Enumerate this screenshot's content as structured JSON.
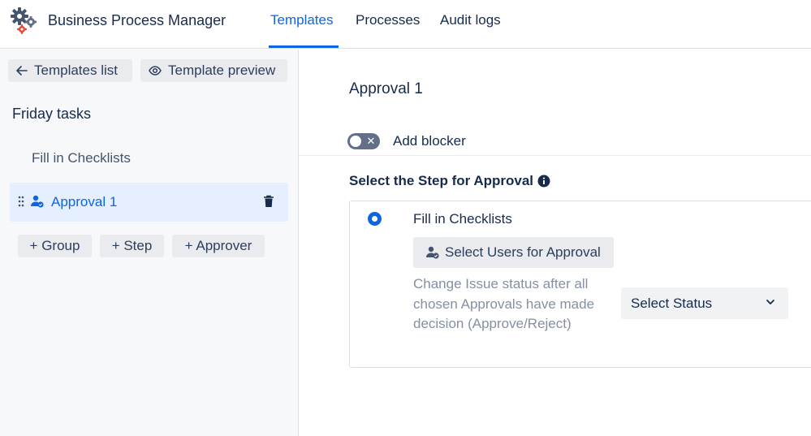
{
  "header": {
    "app_title": "Business Process Manager",
    "logo_icon": "gears-icon",
    "tabs": [
      {
        "label": "Templates",
        "active": true
      },
      {
        "label": "Processes",
        "active": false
      },
      {
        "label": "Audit logs",
        "active": false
      }
    ]
  },
  "sidebar": {
    "back_label": "Templates list",
    "back_icon": "arrow-left-icon",
    "preview_label": "Template preview",
    "preview_icon": "eye-icon",
    "template_name": "Friday tasks",
    "steps": [
      {
        "label": "Fill in Checklists",
        "selected": false
      },
      {
        "label": "Approval 1",
        "selected": true,
        "icon": "approver-icon"
      }
    ],
    "add_buttons": [
      "+ Group",
      "+ Step",
      "+ Approver"
    ]
  },
  "main": {
    "title": "Approval 1",
    "blocker_toggle": {
      "label": "Add blocker",
      "on": false
    },
    "section_title": "Select the Step for Approval",
    "section_icon": "info-icon",
    "card": {
      "step_label": "Fill in Checklists",
      "radio_selected": true,
      "select_users_label": "Select Users for Approval",
      "status_description": "Change Issue status after all chosen Approvals have made decision (Approve/Reject)",
      "status_select_value": "Select Status"
    }
  },
  "colors": {
    "accent": "#0c66e4",
    "selected_bg": "#e6efff",
    "sidebar_bg": "#f7f8f9",
    "button_bg": "#e9ebee",
    "toggle_off": "#626f86"
  }
}
